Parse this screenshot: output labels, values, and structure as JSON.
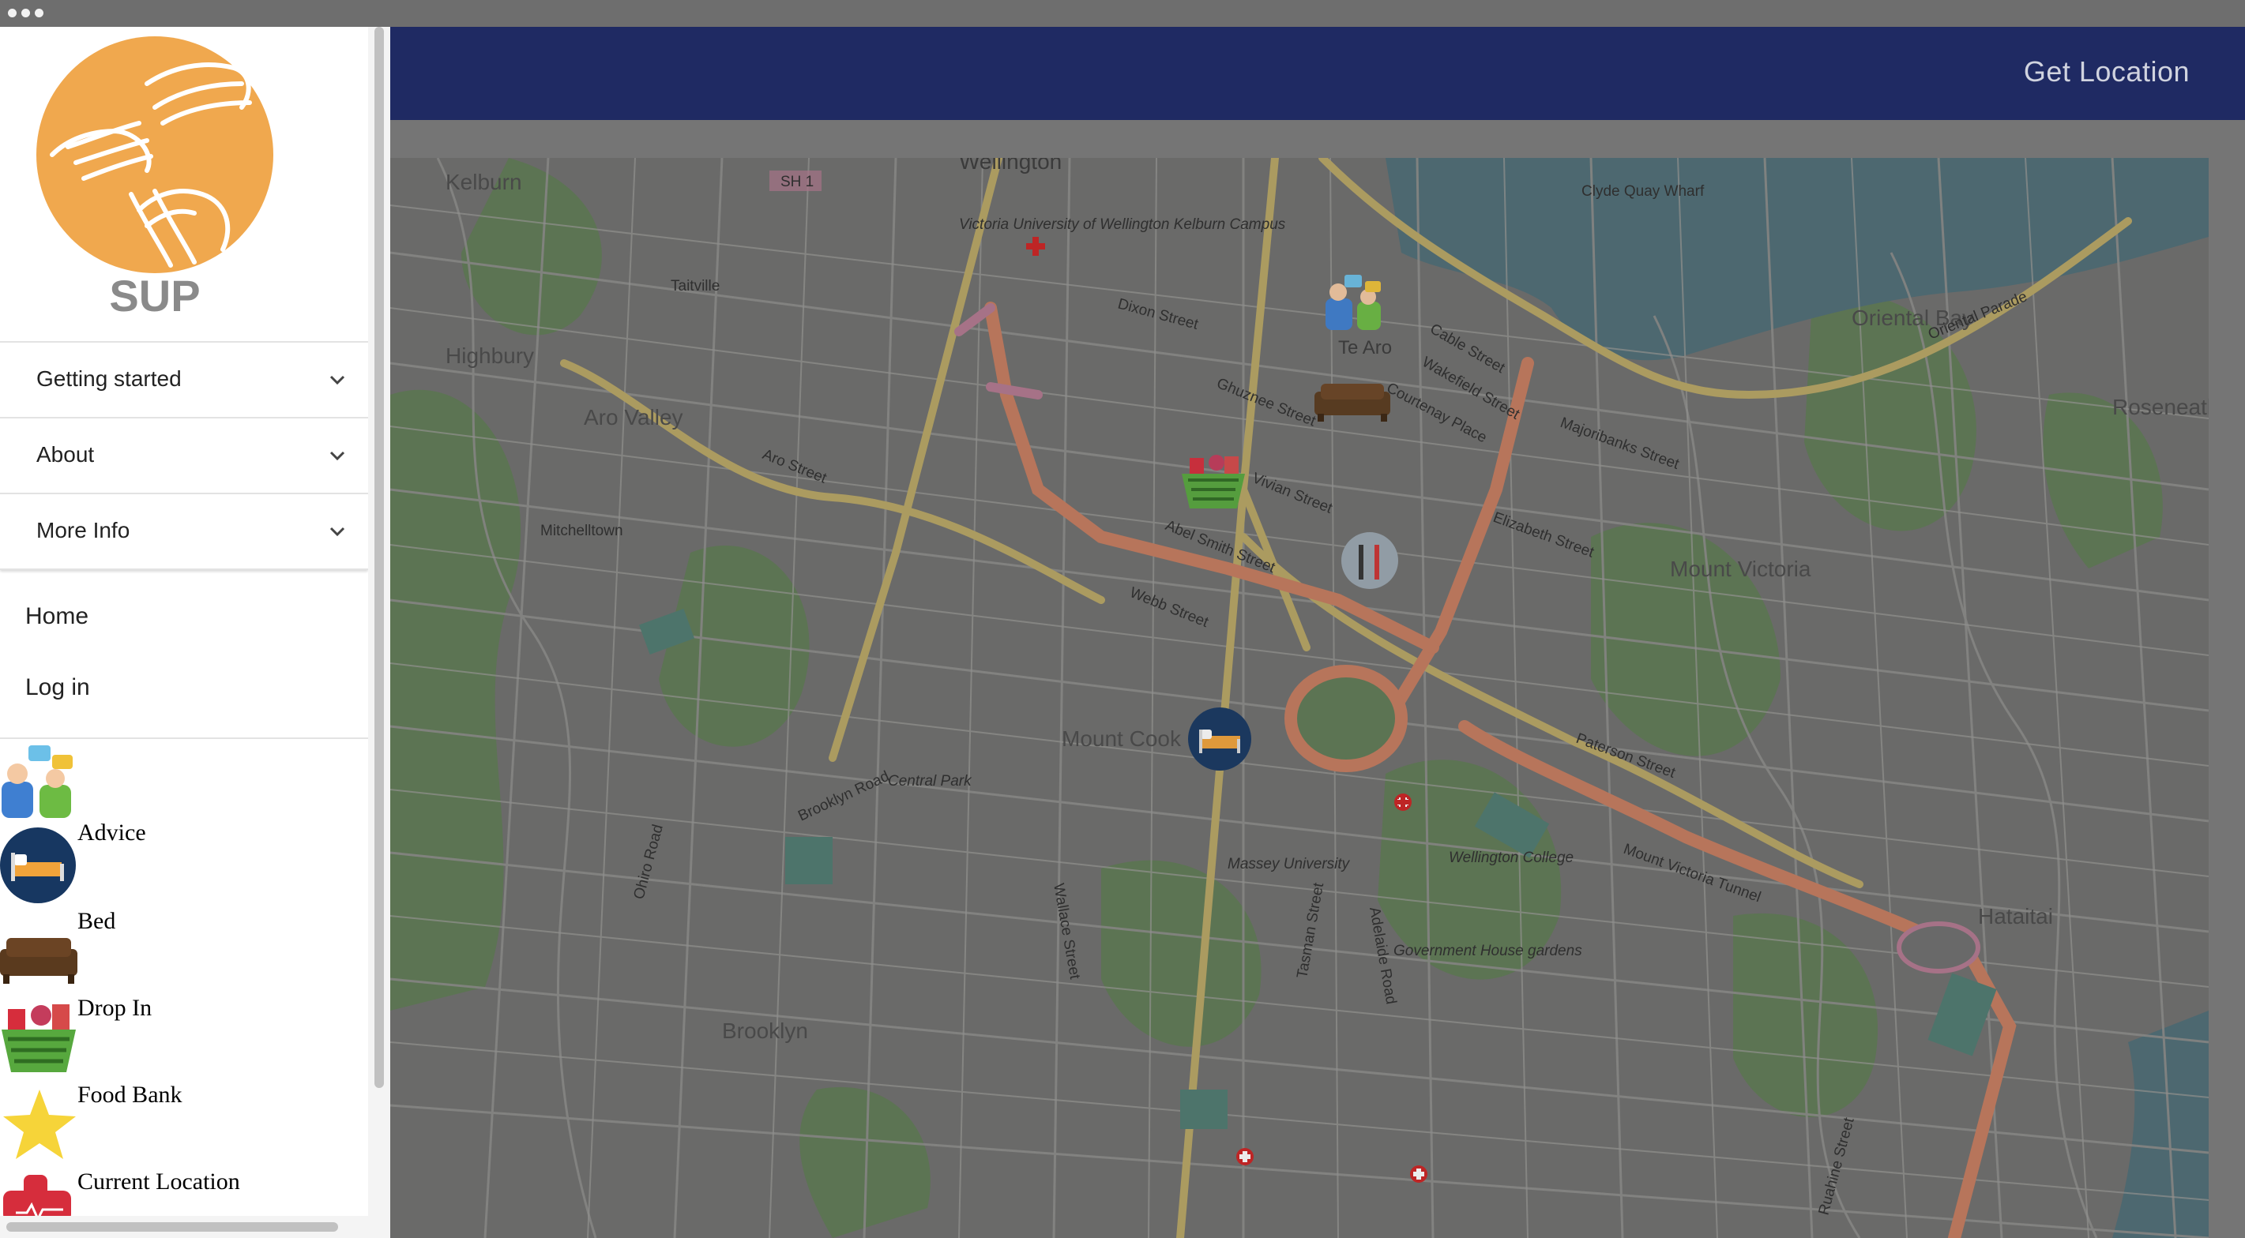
{
  "header": {
    "get_location_label": "Get Location"
  },
  "logo": {
    "text": "SUP"
  },
  "sidebar": {
    "accordion": [
      {
        "label": "Getting started"
      },
      {
        "label": "About"
      },
      {
        "label": "More Info"
      }
    ],
    "links": [
      {
        "label": "Home"
      },
      {
        "label": "Log in"
      }
    ],
    "legend": [
      {
        "label": "Advice",
        "icon": "advice-icon"
      },
      {
        "label": "Bed",
        "icon": "bed-icon"
      },
      {
        "label": "Drop In",
        "icon": "couch-icon"
      },
      {
        "label": "Food Bank",
        "icon": "food-basket-icon"
      },
      {
        "label": "Current Location",
        "icon": "star-icon"
      }
    ]
  },
  "map": {
    "city_label": "Wellington",
    "shield": "SH 1",
    "places": [
      "Kelburn",
      "Highbury",
      "Aro Valley",
      "Mitchelltown",
      "Te Aro",
      "Mount Victoria",
      "Oriental Bay",
      "Roseneath",
      "Hataitai",
      "Brooklyn",
      "Mount Cook",
      "Clyde Quay Wharf",
      "Oriental Bay",
      "Central Park",
      "Wellington College",
      "Government House gardens",
      "Massey University",
      "Victoria University of Wellington Kelburn Campus",
      "Taitville"
    ],
    "streets": [
      "Aro Street",
      "Vivian Street",
      "Ghuznee Street",
      "Webb Street",
      "Abel Smith Street",
      "Cable Street",
      "Wakefield Street",
      "Courtenay Place",
      "Oriental Parade",
      "Mount Victoria Tunnel",
      "Elizabeth Street",
      "Brooklyn Road",
      "Ohiro Road",
      "Wallace Street",
      "Adelaide Road",
      "Dixon Street",
      "Majoribanks Street",
      "Paterson Street",
      "Ruahine Street",
      "Tasman Street"
    ]
  },
  "colors": {
    "topbar": "#1f2a63",
    "logo_orange": "#f0a84e",
    "logo_text": "#8a8a8a"
  }
}
